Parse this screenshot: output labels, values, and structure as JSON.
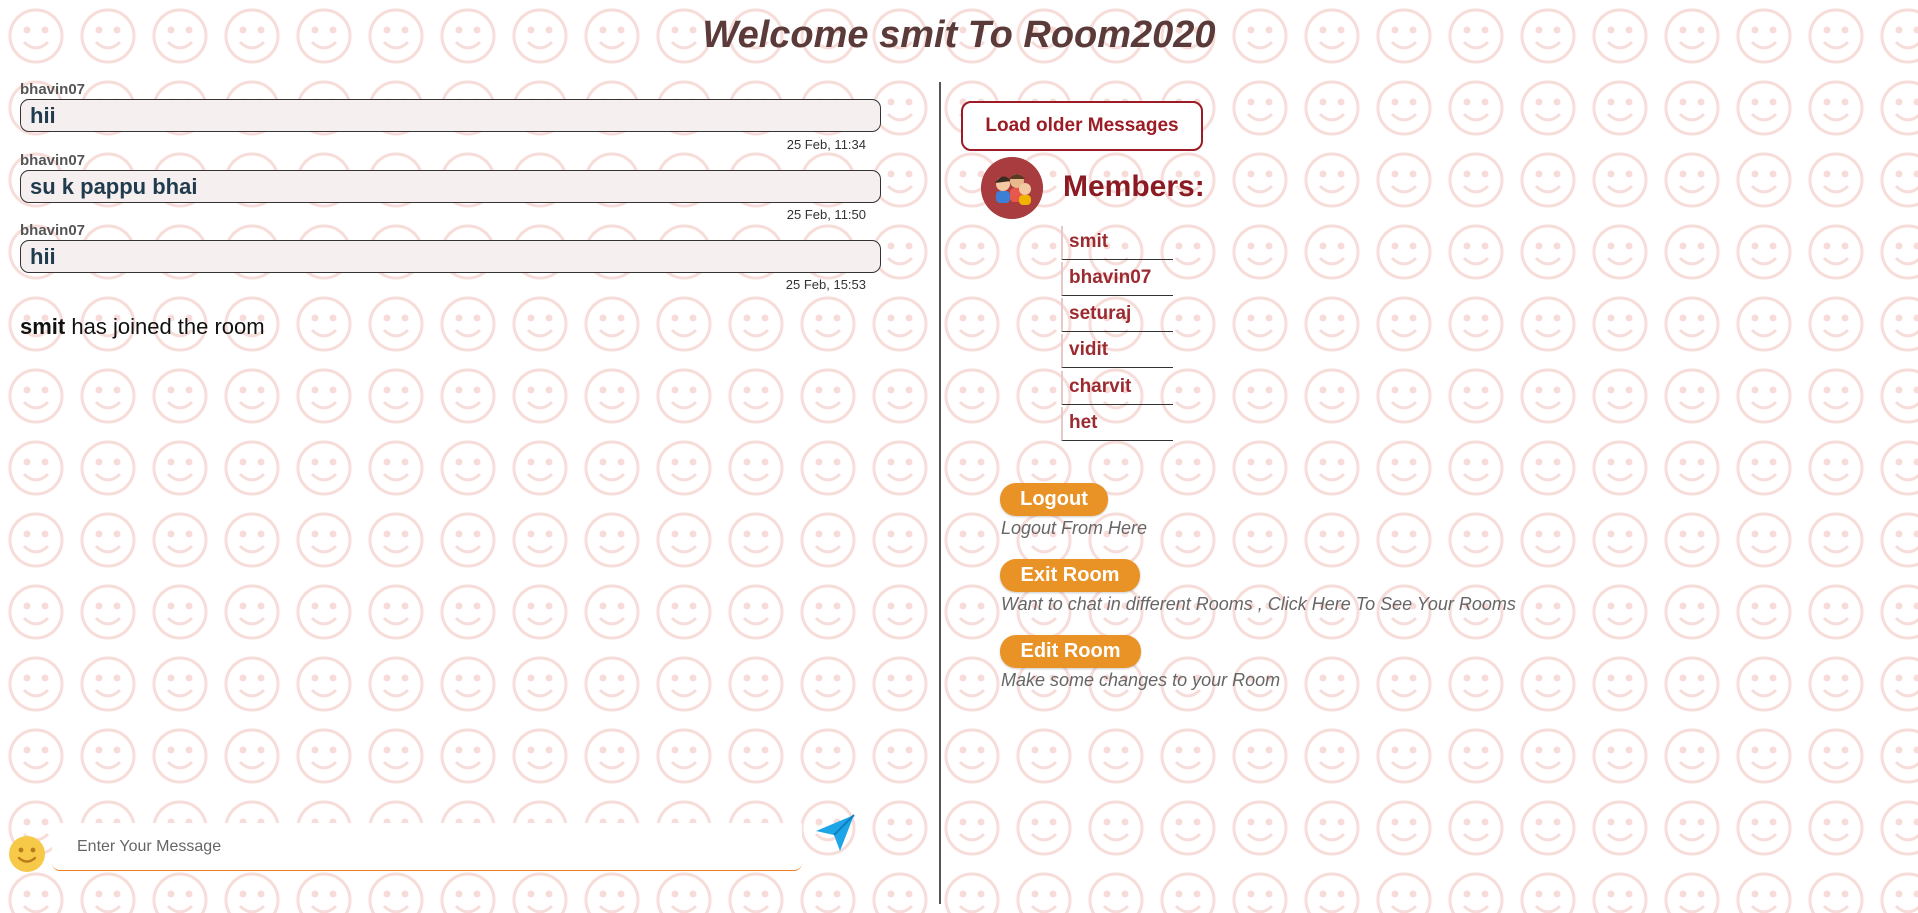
{
  "header": {
    "title": "Welcome smit To Room2020"
  },
  "messages": [
    {
      "sender": "bhavin07",
      "text": "hii",
      "time": "25 Feb, 11:34"
    },
    {
      "sender": "bhavin07",
      "text": "su k pappu bhai",
      "time": "25 Feb, 11:50"
    },
    {
      "sender": "bhavin07",
      "text": "hii",
      "time": "25 Feb, 15:53"
    }
  ],
  "notice": {
    "user": "smit",
    "text": "has joined the room"
  },
  "sidebar": {
    "load_older": "Load older Messages",
    "members_title": "Members:",
    "members": [
      "smit",
      "bhavin07",
      "seturaj",
      "vidit",
      "charvit",
      "het"
    ],
    "actions": [
      {
        "label": "Logout",
        "desc": "Logout From Here"
      },
      {
        "label": "Exit Room",
        "desc": "Want to chat in different Rooms , Click Here To See Your Rooms"
      },
      {
        "label": "Edit Room",
        "desc": "Make some changes to your Room"
      }
    ]
  },
  "composer": {
    "placeholder": "Enter Your Message"
  },
  "colors": {
    "title": "#5b3a3a",
    "accent_red": "#9b1c24",
    "action_orange": "#e99327",
    "send_blue": "#1ea5e8",
    "background_pattern": "#f6d6d2"
  },
  "icons": {
    "emoji": "smiley-emoji-icon",
    "send": "paper-plane-send-icon",
    "members_avatar": "group-avatar-icon"
  }
}
